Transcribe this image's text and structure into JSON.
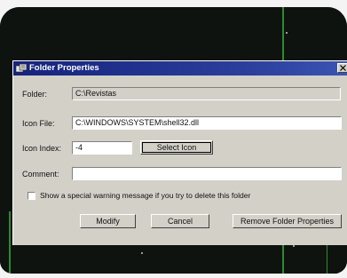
{
  "window": {
    "title": "Folder Properties"
  },
  "form": {
    "folder_label": "Folder:",
    "folder_value": "C:\\Revistas",
    "icon_file_label": "Icon File:",
    "icon_file_value": "C:\\WINDOWS\\SYSTEM\\shell32.dll",
    "icon_index_label": "Icon Index:",
    "icon_index_value": "-4",
    "select_icon_label": "Select Icon",
    "comment_label": "Comment:",
    "comment_value": "",
    "warning_checkbox_label": "Show a special warning message if you try to delete this folder",
    "warning_checked": false
  },
  "buttons": {
    "modify": "Modify",
    "cancel": "Cancel",
    "remove": "Remove Folder Properties"
  },
  "icons": {
    "title": "folder-properties-icon",
    "close": "close-icon"
  },
  "colors": {
    "titlebar": "#1a2a86",
    "dialog_face": "#d3d0c8",
    "screen_accent": "#2f8a2f"
  }
}
